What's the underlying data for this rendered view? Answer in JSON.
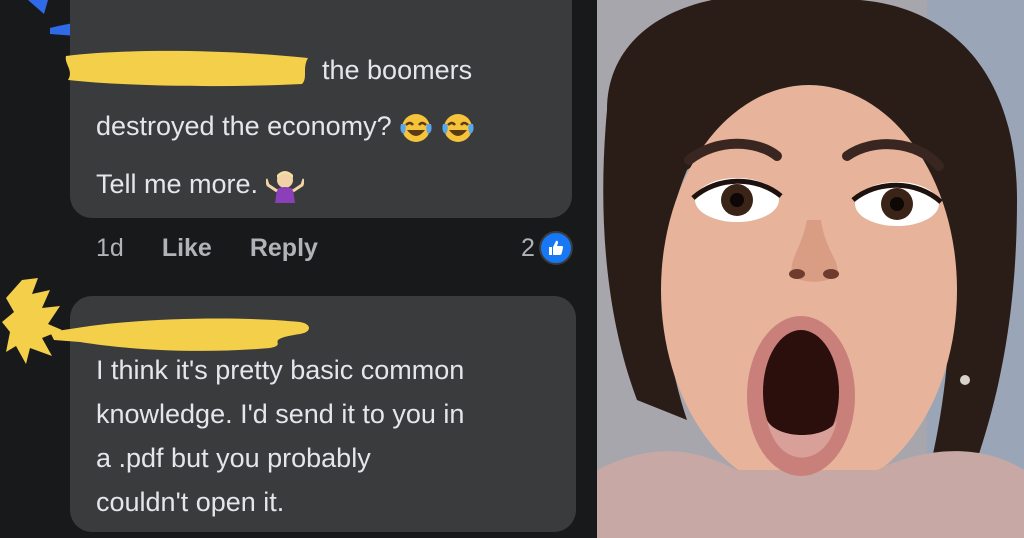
{
  "comment1": {
    "lines": [
      "the boomers",
      "destroyed the economy?",
      "Tell me more."
    ],
    "time": "1d",
    "like_label": "Like",
    "reply_label": "Reply",
    "reaction_count": "2"
  },
  "comment2": {
    "lines": [
      "I think it's pretty basic common",
      "knowledge. I'd send it to you in",
      "a .pdf but you probably",
      "couldn't open it."
    ]
  },
  "colors": {
    "background": "#18191a",
    "bubble": "#3a3b3c",
    "text": "#e4e6eb",
    "meta": "#b0b3b8",
    "like_blue": "#1877f2",
    "redaction_blue": "#2f6be8",
    "redaction_yellow": "#f4cf4a"
  },
  "icons": {
    "laugh": "tears-of-joy-emoji-icon",
    "shrug": "person-shrugging-emoji-icon",
    "like": "thumbs-up-icon"
  }
}
